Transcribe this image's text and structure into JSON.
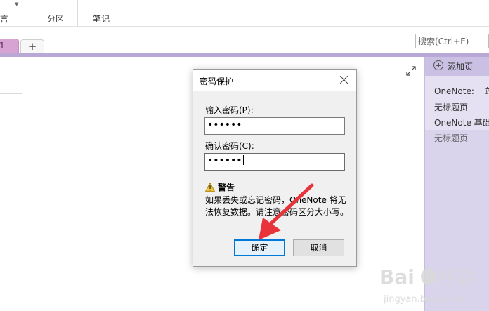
{
  "ribbon": {
    "items": [
      {
        "label": "言"
      },
      {
        "label": "分区"
      },
      {
        "label": "笔记"
      }
    ]
  },
  "tabs": {
    "section_label": "1",
    "add_label": "+"
  },
  "search": {
    "placeholder": "搜索(Ctrl+E)"
  },
  "page_list": {
    "add_page_label": "添加页",
    "pages": [
      {
        "label": "OneNote: 一站"
      },
      {
        "label": "无标题页"
      },
      {
        "label": "OneNote 基础"
      },
      {
        "label": "无标题页"
      }
    ]
  },
  "dialog": {
    "title": "密码保护",
    "enter_label": "输入密码(P):",
    "enter_value": "••••••",
    "confirm_label": "确认密码(C):",
    "confirm_value": "••••••",
    "warning_title": "警告",
    "warning_text": "如果丢失或忘记密码，OneNote 将无法恢复数据。请注意密码区分大小写。",
    "ok_label": "确定",
    "cancel_label": "取消"
  },
  "colors": {
    "section_tab": "#d6a3d2",
    "section_bar": "#b9a7d6",
    "page_list_bg": "#d9d3ec",
    "arrow": "#e8333a",
    "focus_border": "#0078d7"
  },
  "watermark": {
    "brand": "Baidu 经验",
    "url": "jingyan.baidu.com"
  }
}
